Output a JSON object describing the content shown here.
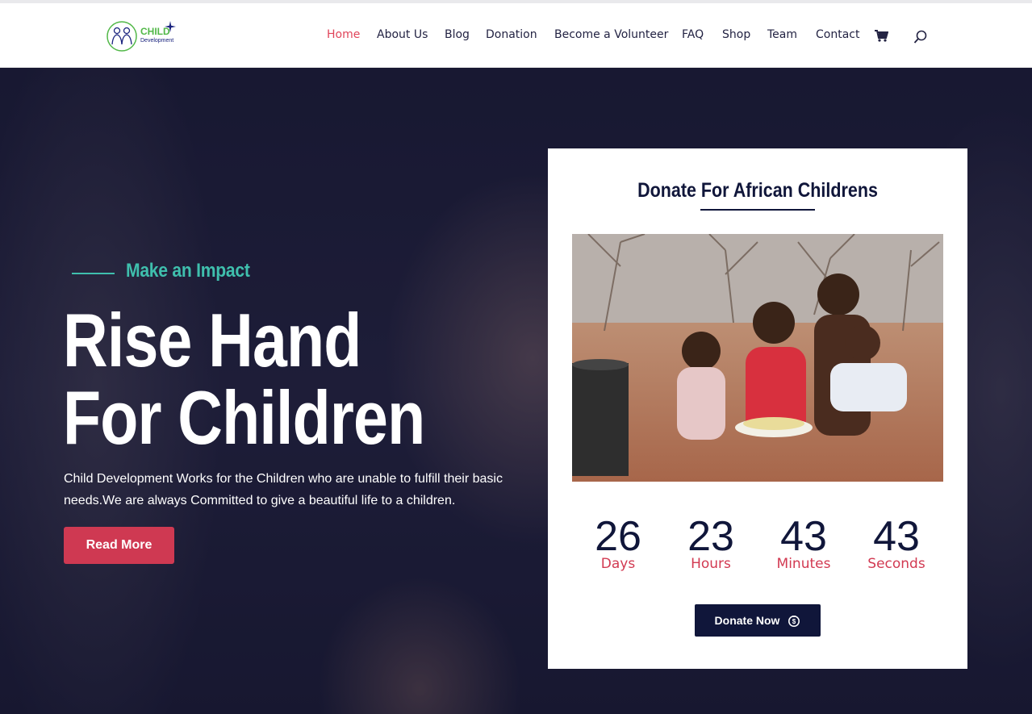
{
  "brand": {
    "name_main": "CHILD",
    "name_sub": "Development"
  },
  "nav": {
    "items": [
      {
        "label": "Home",
        "active": true
      },
      {
        "label": "About Us"
      },
      {
        "label": "Blog"
      },
      {
        "label": "Donation"
      },
      {
        "label": "Become a Volunteer"
      },
      {
        "label": "FAQ"
      },
      {
        "label": "Shop"
      },
      {
        "label": "Team"
      },
      {
        "label": "Contact"
      }
    ],
    "cart_icon": "cart-icon",
    "search_icon": "search-icon"
  },
  "hero": {
    "kicker": "Make an Impact",
    "title_line1": "Rise Hand",
    "title_line2": "For Children",
    "description": "Child Development Works for the Children who are unable to fulfill their basic needs.We are always Committed to give a beautiful life to a children.",
    "cta_label": "Read More"
  },
  "donation_card": {
    "title": "Donate For African Childrens",
    "countdown": [
      {
        "value": "26",
        "label": "Days"
      },
      {
        "value": "23",
        "label": "Hours"
      },
      {
        "value": "43",
        "label": "Minutes"
      },
      {
        "value": "43",
        "label": "Seconds"
      }
    ],
    "button_label": "Donate Now",
    "button_icon": "money-bag-icon"
  },
  "colors": {
    "accent_red": "#cf3952",
    "accent_teal": "#3fbfad",
    "navy": "#10163a",
    "nav_active": "#e0455a"
  }
}
